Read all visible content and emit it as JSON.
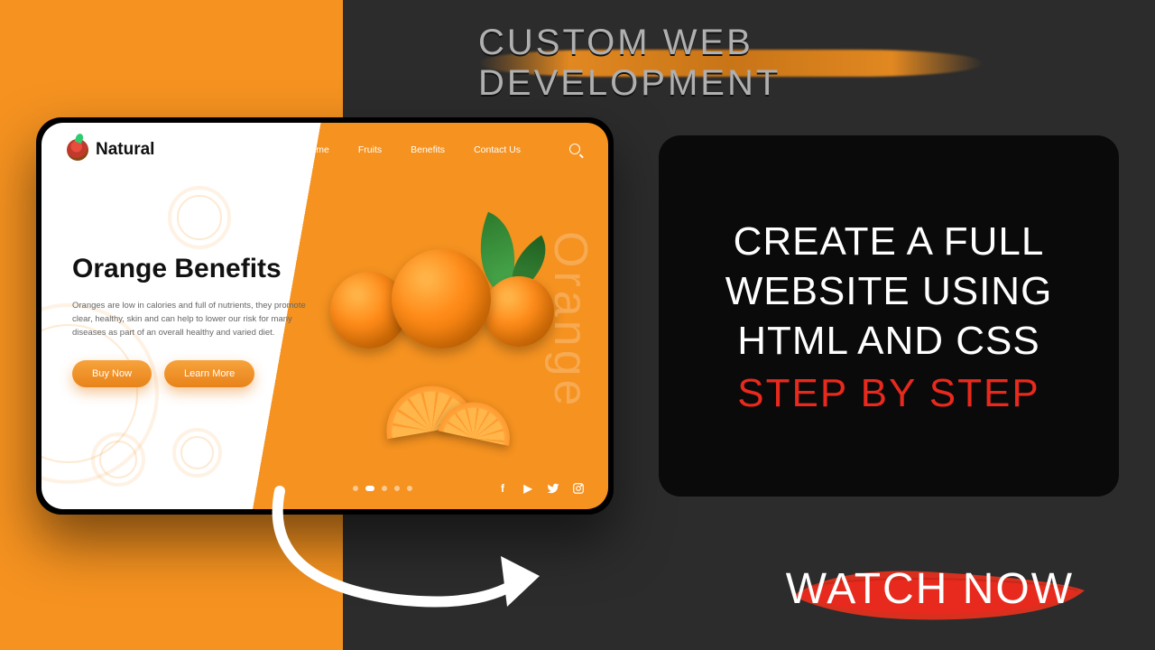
{
  "banner": "CUSTOM WEB DEVELOPMENT",
  "site": {
    "brand": "Natural",
    "nav": {
      "home": "Home",
      "fruits": "Fruits",
      "benefits": "Benefits",
      "contact": "Contact Us"
    },
    "hero": {
      "title": "Orange Benefits",
      "desc": "Oranges are low in calories and full of nutrients, they promote clear, healthy, skin and can help to lower our risk for many diseases as part of an overall healthy and varied diet.",
      "buy": "Buy Now",
      "learn": "Learn More",
      "side_word": "Orange"
    }
  },
  "card": {
    "line1": "CREATE A FULL",
    "line2": "WEBSITE USING",
    "line3": "HTML AND CSS",
    "line4": "STEP BY STEP"
  },
  "cta": "WATCH NOW"
}
